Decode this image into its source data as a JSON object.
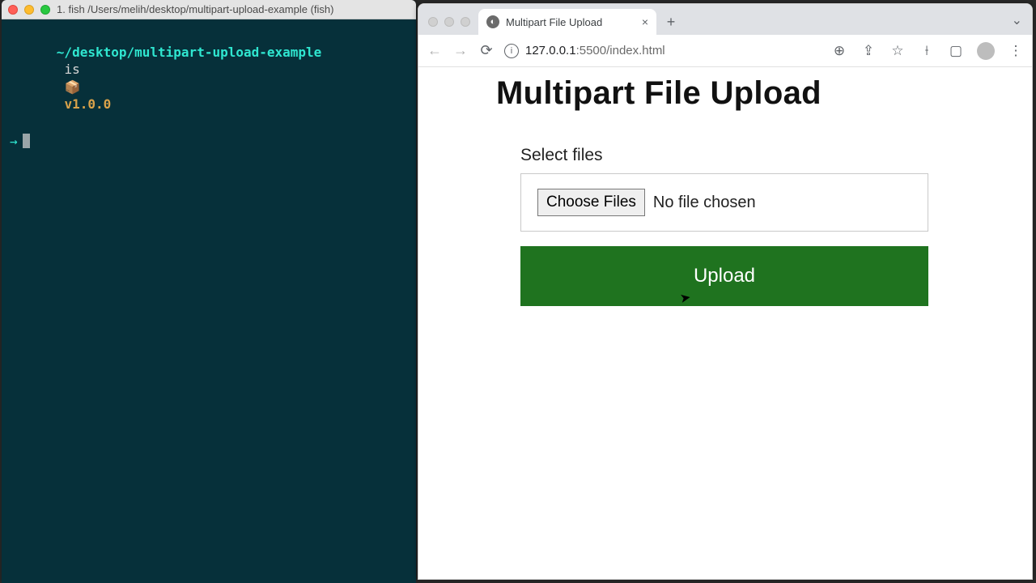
{
  "terminal": {
    "title": "1. fish /Users/melih/desktop/multipart-upload-example (fish)",
    "prompt_path": "~/desktop/multipart-upload-example",
    "prompt_is": "is",
    "prompt_box": "📦",
    "prompt_version": "v1.0.0",
    "prompt_arrow": "→"
  },
  "browser": {
    "tab_title": "Multipart File Upload",
    "new_tab": "+",
    "tab_close": "×",
    "chevron": "⌄",
    "url_host": "127.0.0.1",
    "url_port": ":5500",
    "url_path": "/index.html",
    "icons": {
      "back": "←",
      "forward": "→",
      "reload": "⟳",
      "info": "i",
      "zoom": "⊕",
      "share": "⇪",
      "star": "☆",
      "ext": "⟊",
      "panel": "▢",
      "menu": "⋮"
    }
  },
  "page": {
    "heading": "Multipart File Upload",
    "select_label": "Select files",
    "choose_button": "Choose Files",
    "no_file_text": "No file chosen",
    "upload_button": "Upload"
  }
}
